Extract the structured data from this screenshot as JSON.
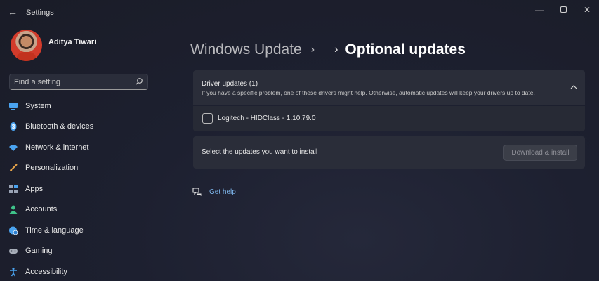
{
  "window": {
    "app_title": "Settings",
    "back_glyph": "←",
    "minimize_glyph": "—",
    "close_glyph": "✕"
  },
  "profile": {
    "name": "Aditya Tiwari"
  },
  "search": {
    "placeholder": "Find a setting",
    "icon": "search-icon"
  },
  "nav": {
    "items": [
      {
        "label": "System",
        "icon": "monitor-icon",
        "color": "#4aa3f0"
      },
      {
        "label": "Bluetooth & devices",
        "icon": "bluetooth-icon",
        "color": "#4aa3f0"
      },
      {
        "label": "Network & internet",
        "icon": "wifi-icon",
        "color": "#4aa3f0"
      },
      {
        "label": "Personalization",
        "icon": "brush-icon",
        "color": "#e9a54a"
      },
      {
        "label": "Apps",
        "icon": "apps-icon",
        "color": "#9aa3b5"
      },
      {
        "label": "Accounts",
        "icon": "person-icon",
        "color": "#3fc38a"
      },
      {
        "label": "Time & language",
        "icon": "globe-clock-icon",
        "color": "#4aa3f0"
      },
      {
        "label": "Gaming",
        "icon": "gamepad-icon",
        "color": "#a7adb8"
      },
      {
        "label": "Accessibility",
        "icon": "accessibility-icon",
        "color": "#4aa3f0"
      }
    ]
  },
  "breadcrumb": {
    "parent": "Windows Update",
    "sep1": "›",
    "sep2": "›",
    "current": "Optional updates"
  },
  "driver_section": {
    "title": "Driver updates (1)",
    "subtitle": "If you have a specific problem, one of these drivers might help. Otherwise, automatic updates will keep your drivers up to date.",
    "drivers": [
      {
        "label": "Logitech - HIDClass - 1.10.79.0",
        "checked": false
      }
    ]
  },
  "install": {
    "label": "Select the updates you want to install",
    "button": "Download & install"
  },
  "help": {
    "label": "Get help"
  },
  "colors": {
    "accent_link": "#7fb8ee",
    "card_bg": "#2a2d39"
  }
}
